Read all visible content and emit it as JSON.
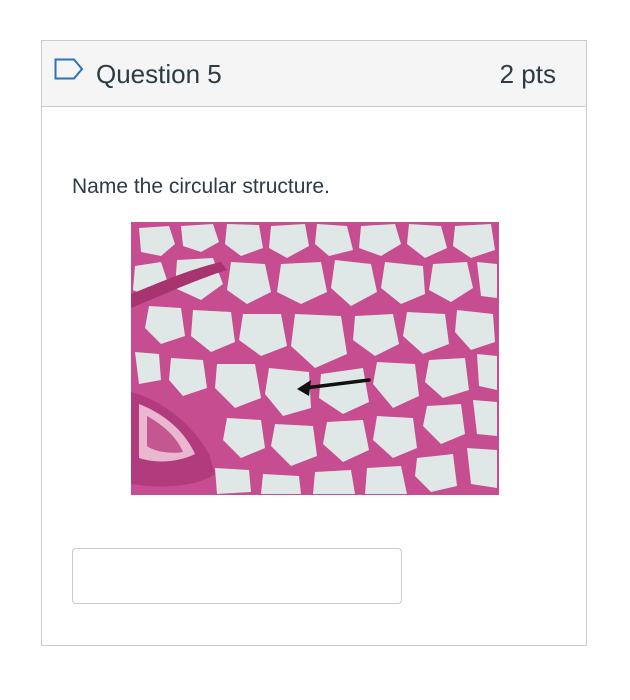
{
  "question": {
    "title": "Question 5",
    "points": "2 pts",
    "text": "Name the circular structure.",
    "flag_icon": "bookmark-flag-icon"
  },
  "image": {
    "subject": "lung-tissue-micrograph",
    "icon": "arrow-pointer-icon"
  },
  "answer": {
    "value": "",
    "placeholder": ""
  },
  "colors": {
    "header_bg": "#f5f5f5",
    "border": "#c7cdd1",
    "tissue": "#b0407f",
    "lumen": "#e4ecea",
    "text": "#2d3b45"
  }
}
